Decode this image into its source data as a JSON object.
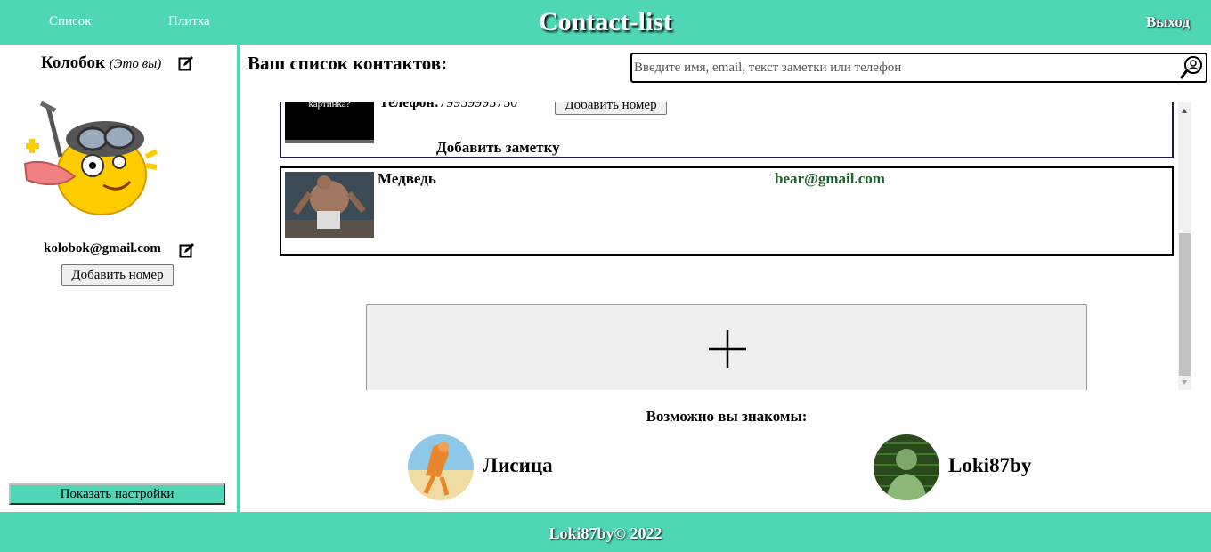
{
  "header": {
    "nav": [
      {
        "label": "Список"
      },
      {
        "label": "Плитка"
      }
    ],
    "title": "Contact-list",
    "logout_label": "Выход"
  },
  "profile": {
    "name": "Колобок",
    "you_label": "(Это вы)",
    "email": "kolobok@gmail.com",
    "add_number_label": "Добавить номер",
    "settings_label": "Показать настройки"
  },
  "main": {
    "title": "Ваш список контактов:",
    "search": {
      "placeholder": "Введите имя, email, текст заметки или телефон",
      "value": ""
    }
  },
  "contacts": [
    {
      "image_caption": "картинка?",
      "phone_label": "Телефон:",
      "phone": "79959993750",
      "add_number_label": "Добавить номер",
      "add_note_label": "Добавить заметку"
    },
    {
      "name": "Медведь",
      "email": "bear@gmail.com"
    }
  ],
  "suggestions": {
    "title": "Возможно вы знакомы:",
    "people": [
      {
        "name": "Лисица"
      },
      {
        "name": "Loki87by"
      }
    ]
  },
  "footer": {
    "copyright": "Loki87by© 2022"
  },
  "colors": {
    "accent": "#4fd6b5",
    "email": "#1e5e2a"
  }
}
